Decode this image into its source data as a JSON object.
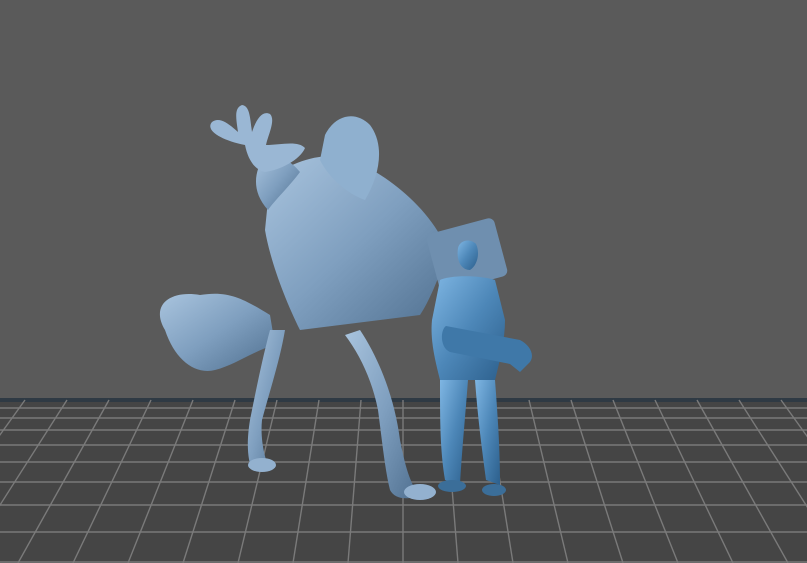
{
  "viewport": {
    "background_color": "#5a5a5a",
    "floor_color": "#454545",
    "grid_line_color": "#7a7a7a",
    "horizon_color": "#2f3a44"
  },
  "models": [
    {
      "name": "hooded-creature-miniature",
      "color": "#7f9fbf"
    },
    {
      "name": "agent-with-rifle-miniature",
      "color": "#4d87b8"
    }
  ]
}
